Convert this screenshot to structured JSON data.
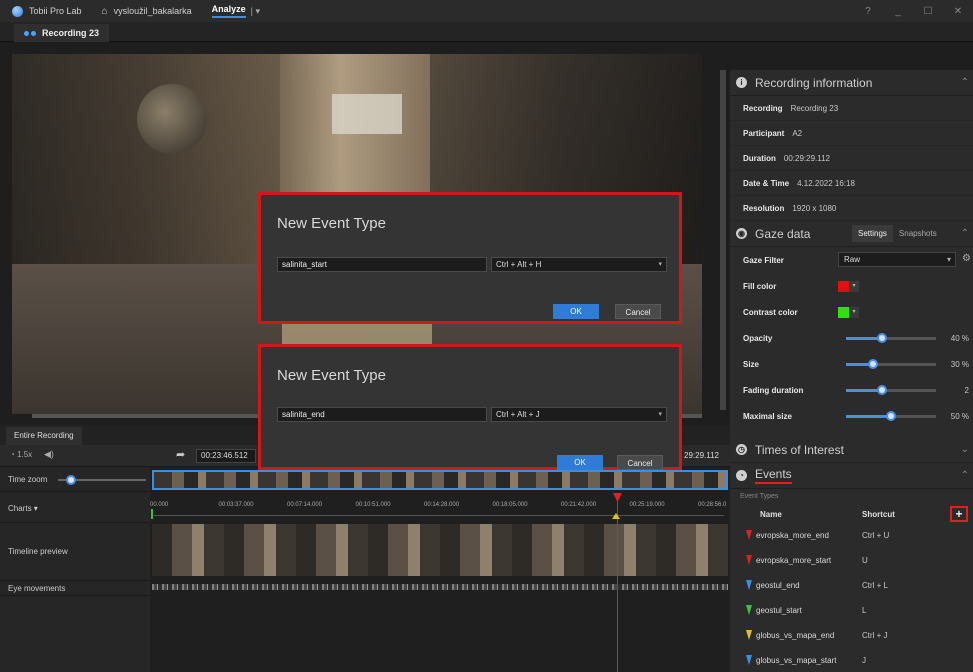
{
  "titlebar": {
    "app_name": "Tobii Pro Lab",
    "project": "vysloužil_bakalarka",
    "mode": "Analyze",
    "mode_caret": "|  ▾",
    "help": "?",
    "minimize": "_",
    "maximize": "☐",
    "close": "✕"
  },
  "recording_tab": {
    "label": "Recording 23"
  },
  "recording_info": {
    "title": "Recording information",
    "rows": [
      {
        "key": "Recording",
        "value": "Recording 23"
      },
      {
        "key": "Participant",
        "value": "A2"
      },
      {
        "key": "Duration",
        "value": "00:29:29.112"
      },
      {
        "key": "Date & Time",
        "value": "4.12.2022 16:18"
      },
      {
        "key": "Resolution",
        "value": "1920 x 1080"
      }
    ]
  },
  "gaze_data": {
    "title": "Gaze data",
    "tabs": [
      "Settings",
      "Snapshots"
    ],
    "gaze_filter_label": "Gaze Filter",
    "gaze_filter_value": "Raw",
    "fill_color_label": "Fill color",
    "fill_color": "#e01010",
    "contrast_color_label": "Contrast color",
    "contrast_color": "#30e010",
    "sliders": [
      {
        "label": "Opacity",
        "fraction": 0.4,
        "value_text": "40 %"
      },
      {
        "label": "Size",
        "fraction": 0.3,
        "value_text": "30 %"
      },
      {
        "label": "Fading duration",
        "fraction": 0.4,
        "value_text": "2"
      },
      {
        "label": "Maximal size",
        "fraction": 0.5,
        "value_text": "50 %"
      }
    ]
  },
  "times_of_interest": {
    "title": "Times of Interest"
  },
  "events": {
    "title": "Events",
    "event_types_label": "Event Types",
    "col_name": "Name",
    "col_shortcut": "Shortcut",
    "add": "+",
    "rows": [
      {
        "name": "evropska_more_end",
        "shortcut": "Ctrl + U",
        "color": "#e02020"
      },
      {
        "name": "evropska_more_start",
        "shortcut": "U",
        "color": "#e02020"
      },
      {
        "name": "geostul_end",
        "shortcut": "Ctrl + L",
        "color": "#3a8fe0"
      },
      {
        "name": "geostul_start",
        "shortcut": "L",
        "color": "#40c040"
      },
      {
        "name": "globus_vs_mapa_end",
        "shortcut": "Ctrl + J",
        "color": "#e0c020"
      },
      {
        "name": "globus_vs_mapa_start",
        "shortcut": "J",
        "color": "#3a8fe0"
      }
    ]
  },
  "timeline": {
    "tab": "Entire Recording",
    "speed": "1.5x",
    "current_time": "00:23:46.512",
    "end_time": "29:29.112",
    "time_zoom_label": "Time zoom",
    "charts_label": "Charts ▾",
    "preview_label": "Timeline preview",
    "eye_movements_label": "Eye movements",
    "ticks": [
      "00.000",
      "00:03:37.000",
      "00:07:14.000",
      "00:10:51.000",
      "00:14:28.000",
      "00:18:05.000",
      "00:21:42.000",
      "00:25:19.000",
      "00:28:56.0"
    ]
  },
  "dialogs": [
    {
      "title": "New Event Type",
      "name_value": "salinita_start",
      "shortcut": "Ctrl + Alt + H",
      "ok": "OK",
      "cancel": "Cancel"
    },
    {
      "title": "New Event Type",
      "name_value": "salinita_end",
      "shortcut": "Ctrl + Alt + J",
      "ok": "OK",
      "cancel": "Cancel"
    }
  ]
}
